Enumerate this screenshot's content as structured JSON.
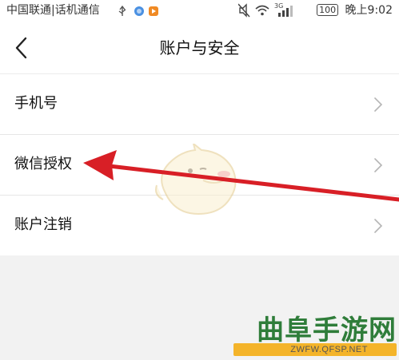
{
  "status_bar": {
    "carrier": "中国联通|话机通信",
    "battery": "100",
    "time": "晚上9:02",
    "network": "3G"
  },
  "header": {
    "title": "账户与安全"
  },
  "list": {
    "items": [
      {
        "label": "手机号"
      },
      {
        "label": "微信授权"
      },
      {
        "label": "账户注销"
      }
    ]
  },
  "watermark": {
    "brand": "曲阜手游网",
    "url": "ZWFW.QFSP.NET"
  },
  "colors": {
    "arrow": "#d81f26",
    "watermark_green": "#2f7d3a",
    "watermark_yellow": "#f4b42a"
  }
}
